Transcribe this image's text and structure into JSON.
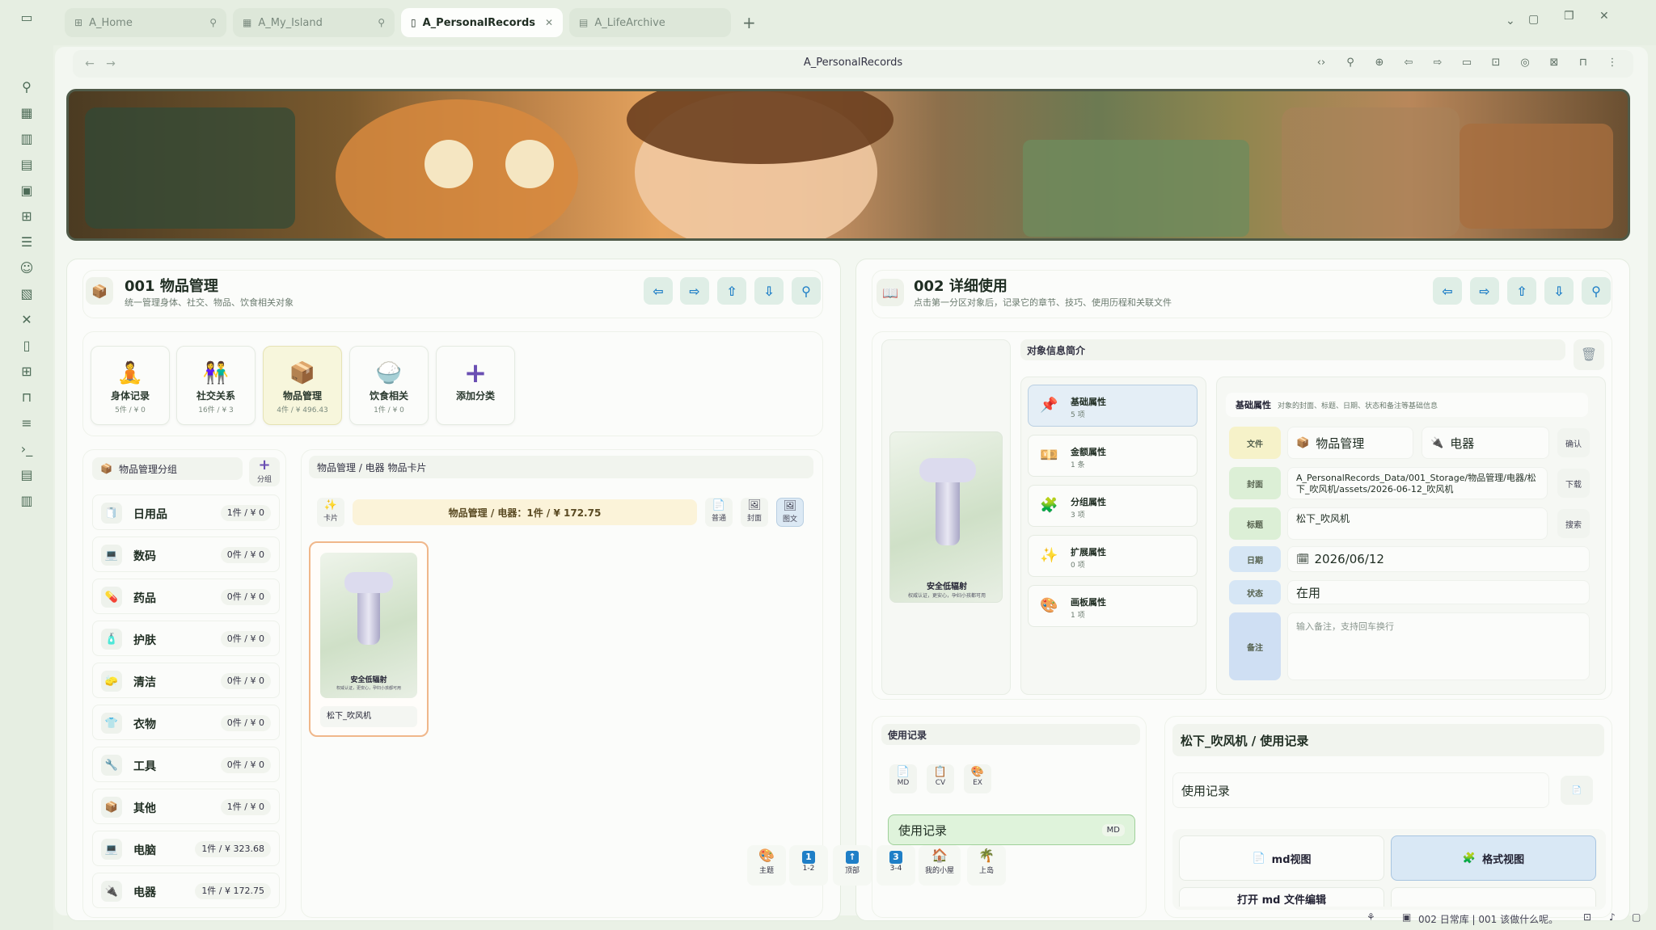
{
  "tabs": [
    {
      "label": "A_Home",
      "icon": "grid-icon"
    },
    {
      "label": "A_My_Island",
      "icon": "map-icon"
    },
    {
      "label": "A_PersonalRecords",
      "icon": "doc-icon"
    },
    {
      "label": "A_LifeArchive",
      "icon": "archive-icon"
    }
  ],
  "address": {
    "title": "A_PersonalRecords"
  },
  "left_panel": {
    "title": "001 物品管理",
    "subtitle": "统一管理身体、社交、物品、饮食相关对象",
    "categories": [
      {
        "label": "身体记录",
        "count": "5件 / ¥ 0"
      },
      {
        "label": "社交关系",
        "count": "16件 / ¥ 3"
      },
      {
        "label": "物品管理",
        "count": "4件 / ¥ 496.43"
      },
      {
        "label": "饮食相关",
        "count": "1件 / ¥ 0"
      },
      {
        "label": "添加分类",
        "count": ""
      }
    ],
    "group_header": "物品管理分组",
    "group_add": "分组",
    "groups": [
      {
        "label": "日用品",
        "count": "1件 / ¥ 0"
      },
      {
        "label": "数码",
        "count": "0件 / ¥ 0"
      },
      {
        "label": "药品",
        "count": "0件 / ¥ 0"
      },
      {
        "label": "护肤",
        "count": "0件 / ¥ 0"
      },
      {
        "label": "清洁",
        "count": "0件 / ¥ 0"
      },
      {
        "label": "衣物",
        "count": "0件 / ¥ 0"
      },
      {
        "label": "工具",
        "count": "0件 / ¥ 0"
      },
      {
        "label": "其他",
        "count": "1件 / ¥ 0"
      },
      {
        "label": "电脑",
        "count": "1件 / ¥ 323.68"
      },
      {
        "label": "电器",
        "count": "1件 / ¥ 172.75"
      }
    ],
    "cards_header": "物品管理 / 电器 物品卡片",
    "card_btn": "卡片",
    "summary": "物品管理 / 电器：1件 / ¥ 172.75",
    "view_btns": [
      "普通",
      "封面",
      "图文"
    ],
    "card": {
      "caption": "安全低辐射",
      "fine": "权威认证，更安心，孕妇小孩都可用",
      "name": "松下_吹风机"
    }
  },
  "right_panel": {
    "title": "002 详细使用",
    "subtitle": "点击第一分区对象后，记录它的章节、技巧、使用历程和关联文件",
    "info_title": "对象信息简介",
    "preview": {
      "caption": "安全低辐射",
      "fine": "权威认证，更安心，孕妇小孩都可用"
    },
    "attrs": [
      {
        "label": "基础属性",
        "count": "5 项"
      },
      {
        "label": "金额属性",
        "count": "1 条"
      },
      {
        "label": "分组属性",
        "count": "3 项"
      },
      {
        "label": "扩展属性",
        "count": "0 项"
      },
      {
        "label": "画板属性",
        "count": "1 项"
      }
    ],
    "form_title": "基础属性",
    "form_desc": "对象的封面、标题、日期、状态和备注等基础信息",
    "labels": {
      "file": "文件",
      "cover": "封面",
      "title": "标题",
      "date": "日期",
      "status": "状态",
      "note": "备注"
    },
    "file_a": "物品管理",
    "file_b": "电器",
    "cover_path": "A_PersonalRecords_Data/001_Storage/物品管理/电器/松下_吹风机/assets/2026-06-12_吹风机",
    "title_value": "松下_吹风机",
    "date_value": "2026/06/12",
    "status_value": "在用",
    "note_placeholder": "输入备注，支持回车换行",
    "side_btns": {
      "confirm": "确认",
      "download": "下载",
      "search": "搜索"
    },
    "usage_header": "使用记录",
    "usage_btns": [
      "MD",
      "CV",
      "EX"
    ],
    "usage_item": "使用记录",
    "usage_tag": "MD",
    "detail_title": "松下_吹风机 / 使用记录",
    "detail_field": "使用记录",
    "md_view": "md视图",
    "fmt_view": "格式视图",
    "open_md": "打开 md 文件编辑"
  },
  "dock": [
    {
      "label": "主题",
      "badge": ""
    },
    {
      "label": "1-2",
      "badge": "1"
    },
    {
      "label": "顶部",
      "badge": ""
    },
    {
      "label": "3-4",
      "badge": "3"
    },
    {
      "label": "我的小屋",
      "badge": ""
    },
    {
      "label": "上岛",
      "badge": ""
    }
  ],
  "status_bar": {
    "text": "002 日常库 | 001 该做什么呢。"
  },
  "colors": {
    "accent_blue": "#1f7fc7",
    "selected_attr": "#e4eef6",
    "label_yellow": "#f6f2c9",
    "label_green": "#dcefd6",
    "label_blue": "#d6e6f5",
    "usage_green": "#dff3db"
  }
}
